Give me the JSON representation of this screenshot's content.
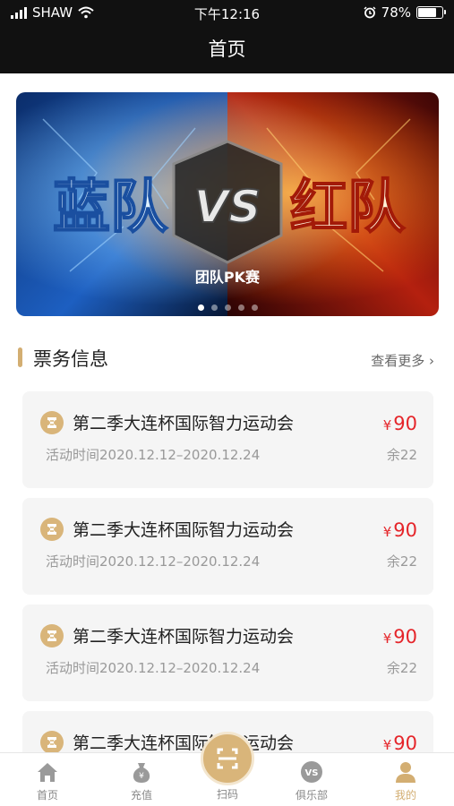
{
  "status_bar": {
    "carrier": "SHAW",
    "time": "下午12:16",
    "battery_percent": "78%",
    "battery_level": 0.78,
    "icons": [
      "signal-icon",
      "wifi-icon",
      "alarm-icon",
      "battery-icon"
    ]
  },
  "nav": {
    "title": "首页"
  },
  "banner": {
    "left_text": "蓝队",
    "vs_text": "VS",
    "right_text": "红队",
    "subtitle": "团队PK赛",
    "dots_count": 5,
    "active_dot": 1
  },
  "section": {
    "title": "票务信息",
    "more_label": "查看更多"
  },
  "tickets": [
    {
      "name": "第二季大连杯国际智力运动会",
      "currency": "¥",
      "price": "90",
      "time": "活动时间2020.12.12–2020.12.24",
      "remain": "余22"
    },
    {
      "name": "第二季大连杯国际智力运动会",
      "currency": "¥",
      "price": "90",
      "time": "活动时间2020.12.12–2020.12.24",
      "remain": "余22"
    },
    {
      "name": "第二季大连杯国际智力运动会",
      "currency": "¥",
      "price": "90",
      "time": "活动时间2020.12.12–2020.12.24",
      "remain": "余22"
    },
    {
      "name": "第二季大连杯国际智力运动会",
      "currency": "¥",
      "price": "90",
      "time": "",
      "remain": ""
    }
  ],
  "tab_bar": {
    "items": [
      {
        "label": "首页",
        "icon": "home-icon"
      },
      {
        "label": "充值",
        "icon": "money-bag-icon"
      },
      {
        "label": "扫码",
        "icon": "scan-icon"
      },
      {
        "label": "俱乐部",
        "icon": "vs-club-icon"
      },
      {
        "label": "我的",
        "icon": "user-icon"
      }
    ],
    "active_index": 4
  },
  "colors": {
    "accent": "#d3ae72",
    "price": "#e5252a",
    "header_bg": "#111111"
  }
}
